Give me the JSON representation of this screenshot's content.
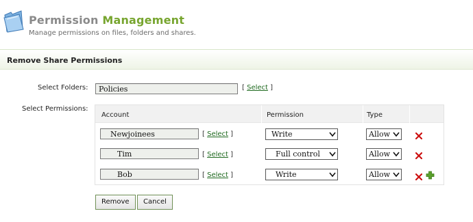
{
  "header": {
    "title_part1": "Permission",
    "title_part2": "Management",
    "subtitle": "Manage permissions on files, folders and shares.",
    "icon": "folder-icon"
  },
  "section": {
    "title": "Remove Share Permissions"
  },
  "form": {
    "folders_label": "Select Folders:",
    "folders_value": "Policies",
    "permissions_label": "Select Permissions:",
    "select_link": "Select",
    "bracket_open": "[",
    "bracket_close": "]"
  },
  "grid": {
    "columns": [
      "Account",
      "Permission",
      "Type"
    ],
    "rows": [
      {
        "account": "Newjoinees",
        "permission": "Write",
        "type": "Allow"
      },
      {
        "account": "Tim",
        "permission": "Full control",
        "type": "Allow"
      },
      {
        "account": "Bob",
        "permission": "Write",
        "type": "Allow"
      }
    ]
  },
  "buttons": {
    "remove": "Remove",
    "cancel": "Cancel"
  },
  "colors": {
    "accent_green": "#77a52f",
    "title_gray": "#8a8a8a",
    "delete_red": "#cc1111",
    "add_green": "#5aa02c"
  }
}
